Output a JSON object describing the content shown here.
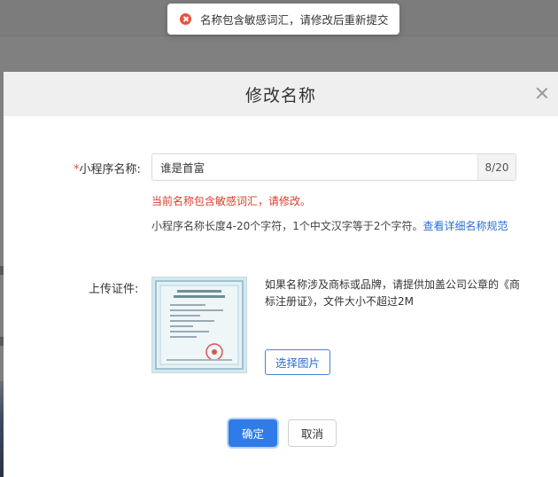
{
  "toast": {
    "icon": "error-circle-icon",
    "message": "名称包含敏感词汇，请修改后重新提交",
    "color": "#e8533c"
  },
  "modal": {
    "title": "修改名称",
    "close_icon": "close-icon"
  },
  "form": {
    "name_field": {
      "required_mark": "*",
      "label": "小程序名称:",
      "value": "谁是首富",
      "counter": "8/20",
      "error": "当前名称包含敏感词汇，请修改。",
      "hint": "小程序名称长度4-20个字符，1个中文汉字等于2个字符。",
      "hint_link": "查看详细名称规范"
    },
    "upload_field": {
      "label": "上传证件:",
      "description": "如果名称涉及商标或品牌，请提供加盖公司公章的《商标注册证》，文件大小不超过2M",
      "select_button": "选择图片"
    }
  },
  "actions": {
    "confirm": "确定",
    "cancel": "取消"
  },
  "colors": {
    "primary": "#2f7ce8",
    "error": "#d93e2b",
    "link": "#2b6fd6",
    "overlay": "#808080"
  }
}
